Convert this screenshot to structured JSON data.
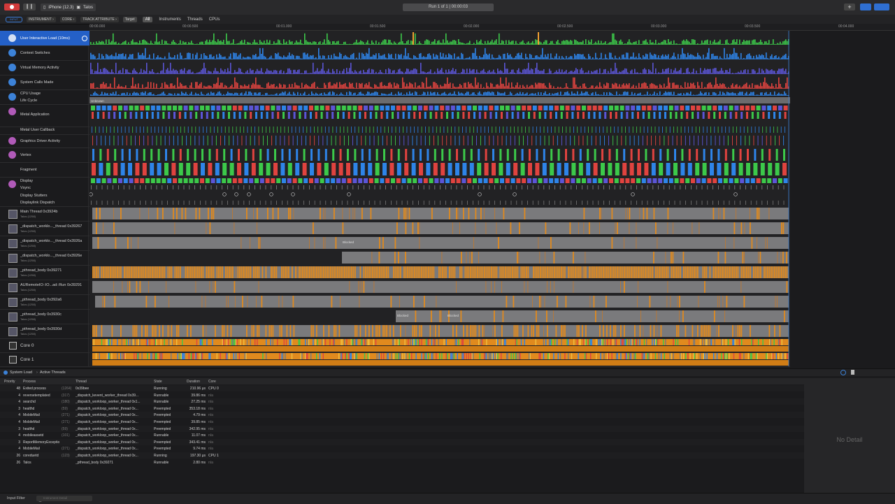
{
  "toolbar": {
    "device": "iPhone (12.3)",
    "app": "Talos",
    "run_status": "Run 1 of 1  |  00:00:03",
    "add_label": "+"
  },
  "filterbar": {
    "filter_toggle": "INPUT",
    "crumbs": [
      "INSTRUMENT ›",
      "CORE ›",
      "TRACK ATTRIBUTE ›",
      "Target"
    ],
    "scopes": [
      "All",
      "Instruments",
      "Threads",
      "CPUs"
    ]
  },
  "ruler": {
    "ticks": [
      "00:00.000",
      "00:00.500",
      "00:01.000",
      "00:01.500",
      "00:02.000",
      "00:02.500",
      "00:03.000",
      "00:03.500",
      "00:04.000"
    ]
  },
  "tracks": [
    {
      "name": "User Interactive Load (10ms)",
      "color": "#3cc94a"
    },
    {
      "name": "Context Switches",
      "color": "#2e84e8"
    },
    {
      "name": "Virtual Memory Activity",
      "color": "#5b55d6"
    },
    {
      "name": "System Calls Made",
      "color": "#e0433f"
    },
    {
      "name": "CPU Usage",
      "sub": "Life Cycle",
      "color": "#2e84e8",
      "life_label": "Unknown"
    },
    {
      "name": "Metal Application"
    },
    {
      "name": "Metal User Callback"
    },
    {
      "name": "Graphics Driver Activity"
    },
    {
      "name": "Vertex"
    },
    {
      "name": "Fragment"
    },
    {
      "name": "Display",
      "sub": "Vsync",
      "sub2": "Display Stutters",
      "sub3": "Displaylink Dispatch"
    }
  ],
  "threads": [
    {
      "name": "Main Thread  0x3924b",
      "proc": "Talos (1258)"
    },
    {
      "name": "_dispatch_worklo..._thread  0x39267",
      "proc": "Talos (1258)"
    },
    {
      "name": "_dispatch_worklo..._thread  0x3926a",
      "proc": "Talos (1258)",
      "label": "Blocked"
    },
    {
      "name": "_dispatch_worklo..._thread  0x3926e",
      "proc": "Talos (1258)"
    },
    {
      "name": "_pthread_body  0x39271",
      "proc": "Talos (1258)"
    },
    {
      "name": "AURemoteIO::IO...ad::Run  0x39291",
      "proc": "Talos (1258)"
    },
    {
      "name": "_pthread_body  0x392a6",
      "proc": "Talos (1258)"
    },
    {
      "name": "_pthread_body  0x3930c",
      "proc": "Talos (1258)",
      "label": "Blocked",
      "label2": "Blocked"
    },
    {
      "name": "_pthread_body  0x3930d",
      "proc": "Talos (1258)"
    }
  ],
  "cores": [
    {
      "name": "Core 0"
    },
    {
      "name": "Core 1"
    }
  ],
  "bottom": {
    "breadcrumb_1": "System Load",
    "breadcrumb_2": "Active Threads",
    "columns": [
      "Priority",
      "Process",
      "Thread",
      "State",
      "Duration",
      "Core"
    ],
    "rows": [
      {
        "priority": "48",
        "process": "Exited process",
        "pid": "(1264)",
        "thread": "0x39bee",
        "state": "Running",
        "duration": "210.96 µs",
        "core": "CPU 0"
      },
      {
        "priority": "4",
        "process": "reversetemplated",
        "pid": "(317)",
        "thread": "_dispatch_kevent_worker_thread  0x39...",
        "state": "Runnable",
        "duration": "39.86 ms",
        "core": "n/a"
      },
      {
        "priority": "4",
        "process": "searchd",
        "pid": "(180)",
        "thread": "_dispatch_workloop_worker_thread  0x1...",
        "state": "Runnable",
        "duration": "27.25 ms",
        "core": "n/a"
      },
      {
        "priority": "3",
        "process": "healthd",
        "pid": "(59)",
        "thread": "_dispatch_workloop_worker_thread  0x...",
        "state": "Preempted",
        "duration": "353.18 ms",
        "core": "n/a"
      },
      {
        "priority": "4",
        "process": "MobileMail",
        "pid": "(271)",
        "thread": "_dispatch_workloop_worker_thread  0x...",
        "state": "Preempted",
        "duration": "4.79 ms",
        "core": "n/a"
      },
      {
        "priority": "4",
        "process": "MobileMail",
        "pid": "(271)",
        "thread": "_dispatch_workloop_worker_thread  0x...",
        "state": "Preempted",
        "duration": "39.85 ms",
        "core": "n/a"
      },
      {
        "priority": "3",
        "process": "healthd",
        "pid": "(59)",
        "thread": "_dispatch_workloop_worker_thread  0x...",
        "state": "Preempted",
        "duration": "342.95 ms",
        "core": "n/a"
      },
      {
        "priority": "4",
        "process": "mobileassetd",
        "pid": "(101)",
        "thread": "_dispatch_workloop_worker_thread  0x...",
        "state": "Runnable",
        "duration": "11.07 ms",
        "core": "n/a"
      },
      {
        "priority": "3",
        "process": "ReportMemoryException...",
        "pid": "",
        "thread": "_dispatch_workloop_worker_thread  0x...",
        "state": "Preempted",
        "duration": "343.41 ms",
        "core": "n/a"
      },
      {
        "priority": "4",
        "process": "MobileMail",
        "pid": "(271)",
        "thread": "_dispatch_workloop_worker_thread  0x...",
        "state": "Preempted",
        "duration": "9.74 ms",
        "core": "n/a"
      },
      {
        "priority": "26",
        "process": "coreduetd",
        "pid": "(123)",
        "thread": "_dispatch_workloop_worker_thread  0x...",
        "state": "Running",
        "duration": "197.30 µs",
        "core": "CPU 1"
      },
      {
        "priority": "26",
        "process": "Talos",
        "pid": "",
        "thread": "_pthread_body  0x39271",
        "state": "Runnable",
        "duration": "2.80 ms",
        "core": "n/a"
      }
    ],
    "no_detail": "No Detail"
  },
  "footer": {
    "input_filter": "Input Filter",
    "detail_placeholder": "Instrument Detail"
  }
}
